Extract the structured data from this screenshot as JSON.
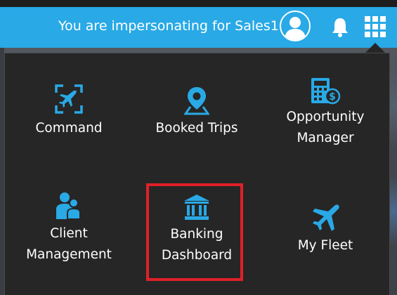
{
  "header": {
    "impersonation_text": "You are impersonating for Sales1",
    "avatar_icon": "user-avatar-icon",
    "bell_icon": "bell-icon",
    "apps_icon": "apps-grid-icon"
  },
  "menu": {
    "items": [
      {
        "label_lines": [
          "Command"
        ],
        "icon": "airplane-target-icon"
      },
      {
        "label_lines": [
          "Booked Trips"
        ],
        "icon": "map-pin-icon"
      },
      {
        "label_lines": [
          "Opportunity",
          "Manager"
        ],
        "icon": "calculator-dollar-icon"
      },
      {
        "label_lines": [
          "Client",
          "Management"
        ],
        "icon": "users-icon"
      },
      {
        "label_lines": [
          "Banking",
          "Dashboard"
        ],
        "icon": "bank-icon"
      },
      {
        "label_lines": [
          "My Fleet"
        ],
        "icon": "airplane-icon"
      }
    ]
  },
  "colors": {
    "header_bg": "#29a9e6",
    "panel_bg": "#262626",
    "icon_accent": "#29a9e6",
    "highlight_border": "#e02028"
  }
}
